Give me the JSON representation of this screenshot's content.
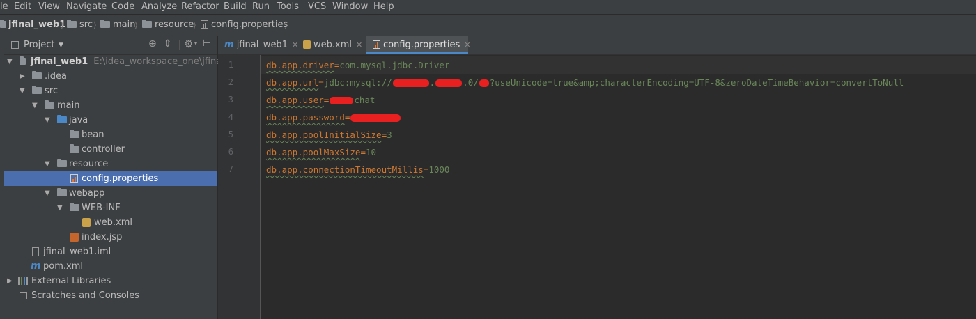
{
  "menu": [
    "le",
    "Edit",
    "View",
    "Navigate",
    "Code",
    "Analyze",
    "Refactor",
    "Build",
    "Run",
    "Tools",
    "VCS",
    "Window",
    "Help"
  ],
  "breadcrumb": [
    "jfinal_web1",
    "src",
    "main",
    "resource",
    "config.properties"
  ],
  "project_panel": {
    "title": "Project",
    "tree": [
      {
        "label": "jfinal_web1",
        "path": "E:\\idea_workspace_one\\jfinal_web"
      },
      {
        "label": ".idea"
      },
      {
        "label": "src"
      },
      {
        "label": "main"
      },
      {
        "label": "java"
      },
      {
        "label": "bean"
      },
      {
        "label": "controller"
      },
      {
        "label": "resource"
      },
      {
        "label": "config.properties"
      },
      {
        "label": "webapp"
      },
      {
        "label": "WEB-INF"
      },
      {
        "label": "web.xml"
      },
      {
        "label": "index.jsp"
      },
      {
        "label": "jfinal_web1.iml"
      },
      {
        "label": "pom.xml"
      },
      {
        "label": "External Libraries"
      },
      {
        "label": "Scratches and Consoles"
      }
    ]
  },
  "tabs": [
    {
      "label": "jfinal_web1"
    },
    {
      "label": "web.xml"
    },
    {
      "label": "config.properties"
    }
  ],
  "editor": {
    "line_numbers": [
      "1",
      "2",
      "3",
      "4",
      "5",
      "6",
      "7"
    ],
    "lines": [
      {
        "key": "db.app.driver",
        "value": "com.mysql.jdbc.Driver"
      },
      {
        "key": "db.app.url",
        "value_prefix": "jdbc:mysql://",
        "value_mid1": ".",
        "value_mid2": ".0/",
        "value_suffix": "?useUnicode=true&amp;characterEncoding=UTF-8&zeroDateTimeBehavior=convertToNull"
      },
      {
        "key": "db.app.user",
        "value_suffix": "chat"
      },
      {
        "key": "db.app.password"
      },
      {
        "key": "db.app.poolInitialSize",
        "value": "3"
      },
      {
        "key": "db.app.poolMaxSize",
        "value": "10"
      },
      {
        "key": "db.app.connectionTimeoutMillis",
        "value": "1000"
      }
    ]
  },
  "colors": {
    "accent": "#4a88c7",
    "selection": "#4b6eaf",
    "redaction": "#e8201f"
  }
}
